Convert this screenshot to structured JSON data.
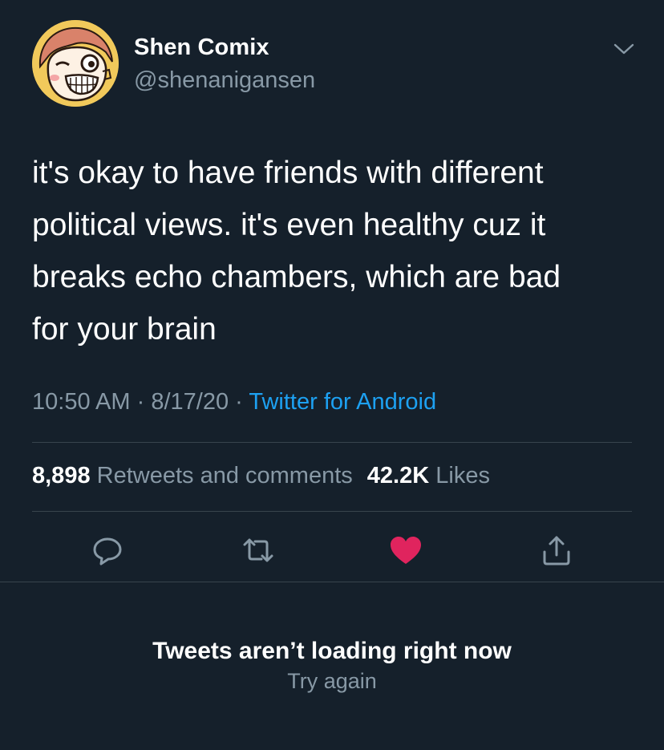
{
  "tweet": {
    "author": {
      "display_name": "Shen Comix",
      "handle": "@shenanigansen",
      "avatar_icon": "cartoon-face-avatar"
    },
    "menu_icon": "chevron-down-icon",
    "text_lines": [
      "it's okay to have friends with different",
      "political views. it's even healthy cuz it",
      "breaks echo chambers, which are bad",
      "for your brain"
    ],
    "time": "10:50 AM",
    "date": "8/17/20",
    "separator": "·",
    "source": "Twitter for Android",
    "stats": {
      "retweets_count": "8,898",
      "retweets_label": "Retweets and comments",
      "likes_count": "42.2K",
      "likes_label": "Likes"
    },
    "actions": [
      {
        "name": "reply",
        "icon": "speech-bubble-icon"
      },
      {
        "name": "retweet",
        "icon": "retweet-arrows-icon"
      },
      {
        "name": "like",
        "icon": "heart-icon",
        "active": true
      },
      {
        "name": "share",
        "icon": "share-upload-icon"
      }
    ]
  },
  "replies_error": {
    "title": "Tweets aren’t loading right now",
    "retry": "Try again"
  },
  "colors": {
    "background": "#15202b",
    "primary_text": "#ffffff",
    "secondary_text": "#8899a6",
    "link": "#1da1f2",
    "like_active": "#e0245e",
    "divider": "#38444d"
  }
}
